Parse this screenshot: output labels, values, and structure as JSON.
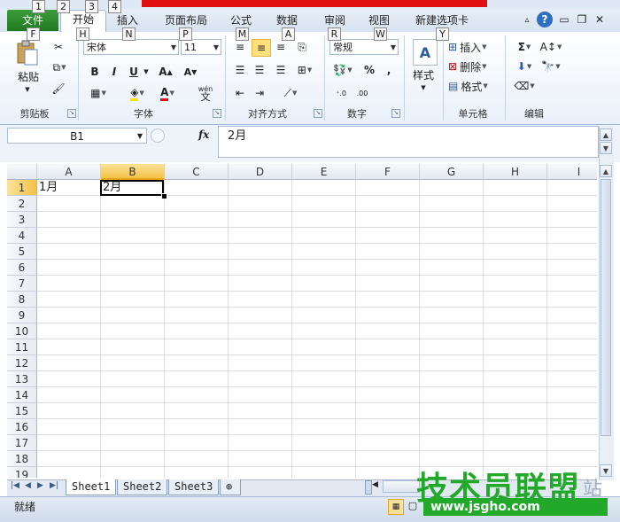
{
  "quick_access_keys": [
    "1",
    "2",
    "3",
    "4"
  ],
  "tabs": [
    {
      "label": "文件",
      "key": "F"
    },
    {
      "label": "开始",
      "key": "H"
    },
    {
      "label": "插入",
      "key": "N"
    },
    {
      "label": "页面布局",
      "key": "P"
    },
    {
      "label": "公式",
      "key": "M"
    },
    {
      "label": "数据",
      "key": "A"
    },
    {
      "label": "审阅",
      "key": "R"
    },
    {
      "label": "视图",
      "key": "W"
    },
    {
      "label": "新建选项卡",
      "key": "Y"
    }
  ],
  "ribbon": {
    "clipboard": {
      "paste": "粘贴",
      "label": "剪贴板"
    },
    "font": {
      "name": "宋体",
      "size": "11",
      "bold": "B",
      "italic": "I",
      "underline": "U",
      "grow": "A",
      "shrink": "A",
      "color_a": "A",
      "wen": "wén",
      "wen2": "文",
      "label": "字体"
    },
    "alignment": {
      "label": "对齐方式"
    },
    "number": {
      "format": "常规",
      "percent": "%",
      "comma": ",",
      "label": "数字"
    },
    "styles": {
      "label": "样式"
    },
    "cells": {
      "insert": "插入",
      "delete": "删除",
      "format": "格式",
      "label": "单元格"
    },
    "editing": {
      "sum": "Σ",
      "label": "编辑"
    }
  },
  "formula_bar": {
    "name_box": "B1",
    "fx": "fx",
    "content": "2月"
  },
  "columns": [
    "A",
    "B",
    "C",
    "D",
    "E",
    "F",
    "G",
    "H",
    "I"
  ],
  "rows": [
    "1",
    "2",
    "3",
    "4",
    "5",
    "6",
    "7",
    "8",
    "9",
    "10",
    "11",
    "12",
    "13",
    "14",
    "15",
    "16",
    "17",
    "18",
    "19"
  ],
  "cells": {
    "A1": "1月",
    "B1": "2月"
  },
  "active_cell": "B1",
  "sheets": [
    "Sheet1",
    "Sheet2",
    "Sheet3"
  ],
  "active_sheet": "Sheet1",
  "status": "就绪",
  "watermark": {
    "title": "技术员联盟",
    "url": "www.jsgho.com",
    "suffix": "站"
  },
  "colors": {
    "accent": "#23a92a",
    "file_tab": "#2a8a2a",
    "selection": "#f5c247"
  }
}
